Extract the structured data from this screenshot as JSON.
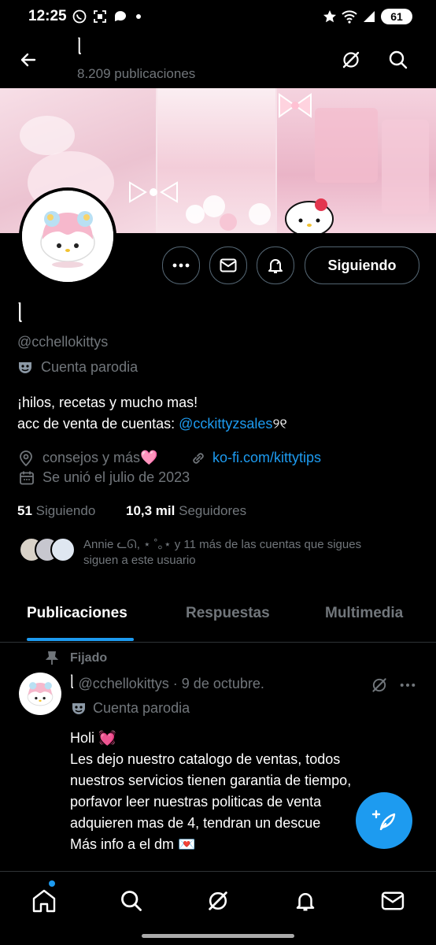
{
  "status_bar": {
    "time": "12:25",
    "battery": "61"
  },
  "header": {
    "title": "ᥣ",
    "posts_count": "8.209 publicaciones"
  },
  "profile": {
    "name": "ᥣ",
    "handle": "@cchellokittys",
    "parody_label": "Cuenta parodia",
    "bio_line1": "¡hilos, recetas y mucho mas!",
    "bio_line2_prefix": "acc de venta de cuentas: ",
    "bio_link": "@cckittyzsales",
    "bio_suffix": "୨୧",
    "location": "consejos y más",
    "heart": "🩷",
    "website": "ko-fi.com/kittytips",
    "joined": "Se unió el julio de 2023",
    "following_count": "51",
    "following_label": "Siguiendo",
    "followers_count": "10,3 mil",
    "followers_label": "Seguidores",
    "followed_by_line1": "Annie ᓚᘏ, ⋆ ˚｡⋆ y 11 más de las cuentas que sigues",
    "followed_by_line2": "siguen a este usuario"
  },
  "actions": {
    "following_button": "Siguiendo"
  },
  "tabs": [
    {
      "label": "Publicaciones",
      "active": true
    },
    {
      "label": "Respuestas",
      "active": false
    },
    {
      "label": "Multimedia",
      "active": false
    }
  ],
  "post": {
    "pinned_label": "Fijado",
    "author_name": "ᥣ",
    "author_handle": "@cchellokittys",
    "time": "· 9 de octubre.",
    "parody_label": "Cuenta parodia",
    "lines": [
      "Holi 💓",
      "Les dejo nuestro catalogo de ventas, todos",
      "nuestros servicios tienen garantia de tiempo,",
      "porfavor leer nuestras politicas de venta",
      "adquieren mas de 4, tendran un descue",
      "Más info a el dm 💌"
    ]
  },
  "colors": {
    "accent": "#1d9bf0",
    "muted": "#71767b",
    "border": "#536471",
    "background": "#000000"
  },
  "icons": [
    "back-arrow-icon",
    "grok-icon",
    "search-icon",
    "more-icon",
    "mail-icon",
    "notification-bell-icon",
    "location-icon",
    "link-icon",
    "calendar-icon",
    "parody-mask-icon",
    "pin-icon",
    "compose-icon",
    "home-icon",
    "bell-icon"
  ]
}
